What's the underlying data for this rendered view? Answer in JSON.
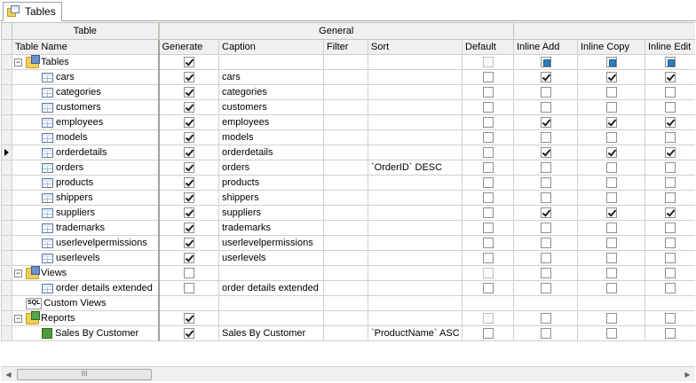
{
  "tab": {
    "label": "Tables",
    "icon": "tables-icon"
  },
  "bands": {
    "table": "Table",
    "general": "General"
  },
  "columns": [
    "Table Name",
    "Generate",
    "Caption",
    "Filter",
    "Sort",
    "Default",
    "Inline Add",
    "Inline Copy",
    "Inline Edit"
  ],
  "rows": [
    {
      "kind": "group",
      "icon": "tables-folder-icon",
      "name": "Tables",
      "gen": "on",
      "caption": "",
      "sort": "",
      "def": "dis",
      "add": "ind",
      "copy": "ind",
      "edit": "ind"
    },
    {
      "kind": "table",
      "name": "cars",
      "gen": "on",
      "caption": "cars",
      "sort": "",
      "def": "off",
      "add": "on",
      "copy": "on",
      "edit": "on"
    },
    {
      "kind": "table",
      "name": "categories",
      "gen": "on",
      "caption": "categories",
      "sort": "",
      "def": "off",
      "add": "off",
      "copy": "off",
      "edit": "off"
    },
    {
      "kind": "table",
      "name": "customers",
      "gen": "on",
      "caption": "customers",
      "sort": "",
      "def": "off",
      "add": "off",
      "copy": "off",
      "edit": "off"
    },
    {
      "kind": "table",
      "name": "employees",
      "gen": "on",
      "caption": "employees",
      "sort": "",
      "def": "off",
      "add": "on",
      "copy": "on",
      "edit": "on"
    },
    {
      "kind": "table",
      "name": "models",
      "gen": "on",
      "caption": "models",
      "sort": "",
      "def": "off",
      "add": "off",
      "copy": "off",
      "edit": "off"
    },
    {
      "kind": "table",
      "name": "orderdetails",
      "gen": "on",
      "caption": "orderdetails",
      "sort": "",
      "def": "off",
      "add": "on",
      "copy": "on",
      "edit": "on",
      "current": true
    },
    {
      "kind": "table",
      "name": "orders",
      "gen": "on",
      "caption": "orders",
      "sort": "`OrderID` DESC",
      "def": "off",
      "add": "off",
      "copy": "off",
      "edit": "off"
    },
    {
      "kind": "table",
      "name": "products",
      "gen": "on",
      "caption": "products",
      "sort": "",
      "def": "off",
      "add": "off",
      "copy": "off",
      "edit": "off"
    },
    {
      "kind": "table",
      "name": "shippers",
      "gen": "on",
      "caption": "shippers",
      "sort": "",
      "def": "off",
      "add": "off",
      "copy": "off",
      "edit": "off"
    },
    {
      "kind": "table",
      "name": "suppliers",
      "gen": "on",
      "caption": "suppliers",
      "sort": "",
      "def": "off",
      "add": "on",
      "copy": "on",
      "edit": "on"
    },
    {
      "kind": "table",
      "name": "trademarks",
      "gen": "on",
      "caption": "trademarks",
      "sort": "",
      "def": "off",
      "add": "off",
      "copy": "off",
      "edit": "off"
    },
    {
      "kind": "table",
      "name": "userlevelpermissions",
      "gen": "on",
      "caption": "userlevelpermissions",
      "sort": "",
      "def": "off",
      "add": "off",
      "copy": "off",
      "edit": "off"
    },
    {
      "kind": "table",
      "name": "userlevels",
      "gen": "on",
      "caption": "userlevels",
      "sort": "",
      "def": "off",
      "add": "off",
      "copy": "off",
      "edit": "off"
    },
    {
      "kind": "group",
      "icon": "views-folder-icon",
      "name": "Views",
      "gen": "off",
      "caption": "",
      "sort": "",
      "def": "dis",
      "add": "off",
      "copy": "off",
      "edit": "off"
    },
    {
      "kind": "table",
      "name": "order details extended",
      "gen": "off",
      "caption": "order details extended",
      "sort": "",
      "def": "off",
      "add": "off",
      "copy": "off",
      "edit": "off"
    },
    {
      "kind": "custom",
      "icon": "sql-icon",
      "name": "Custom Views",
      "gen": "",
      "caption": "",
      "sort": "",
      "def": "",
      "add": "",
      "copy": "",
      "edit": ""
    },
    {
      "kind": "group",
      "icon": "reports-folder-icon",
      "name": "Reports",
      "gen": "on",
      "caption": "",
      "sort": "",
      "def": "dis",
      "add": "off",
      "copy": "off",
      "edit": "off"
    },
    {
      "kind": "report",
      "name": "Sales By Customer",
      "gen": "on",
      "caption": "Sales By Customer",
      "sort": "`ProductName` ASC",
      "def": "off",
      "add": "off",
      "copy": "off",
      "edit": "off"
    }
  ],
  "scrollbar": {
    "left_arrow": "◀",
    "right_arrow": "▶",
    "thumb_grip": "III"
  }
}
